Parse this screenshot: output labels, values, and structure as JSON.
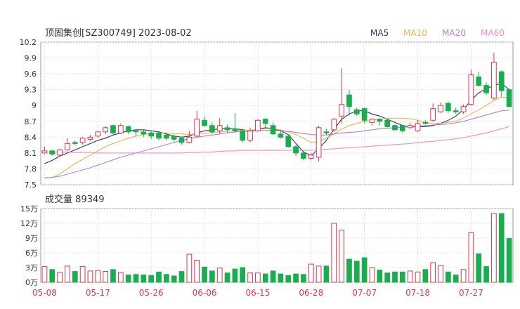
{
  "header": {
    "title": "顶固集创[SZ300749] 2023-08-02",
    "legend": [
      {
        "label": "MA5",
        "color": "#333366"
      },
      {
        "label": "MA10",
        "color": "#f0b24a"
      },
      {
        "label": "MA20",
        "color": "#b27fdc"
      },
      {
        "label": "MA60",
        "color": "#f08cc8"
      }
    ]
  },
  "volume_label": {
    "prefix": "成交量",
    "value": "89349"
  },
  "chart_data": [
    {
      "type": "candlestick",
      "title": "顶固集创[SZ300749] 2023-08-02",
      "y_ticks": [
        "10.2",
        "9.9",
        "9.6",
        "9.3",
        "9",
        "8.7",
        "8.4",
        "8.1",
        "7.8",
        "7.5"
      ],
      "ylim": [
        7.5,
        10.2
      ],
      "grid": true,
      "x_ticks": [
        {
          "i": 0,
          "label": "05-08"
        },
        {
          "i": 7,
          "label": "05-17"
        },
        {
          "i": 14,
          "label": "05-26"
        },
        {
          "i": 21,
          "label": "06-06"
        },
        {
          "i": 28,
          "label": "06-15"
        },
        {
          "i": 35,
          "label": "06-28"
        },
        {
          "i": 42,
          "label": "07-07"
        },
        {
          "i": 49,
          "label": "07-18"
        },
        {
          "i": 56,
          "label": "07-27"
        }
      ],
      "colors": {
        "up": "#e0344a",
        "down": "#1aad4f"
      },
      "candles": [
        [
          8.1,
          8.14,
          8.22,
          8.08
        ],
        [
          8.14,
          8.08,
          8.16,
          8.05
        ],
        [
          8.06,
          8.16,
          8.18,
          8.03
        ],
        [
          8.16,
          8.28,
          8.38,
          8.14
        ],
        [
          8.3,
          8.28,
          8.34,
          8.25
        ],
        [
          8.3,
          8.38,
          8.4,
          8.26
        ],
        [
          8.36,
          8.4,
          8.44,
          8.33
        ],
        [
          8.42,
          8.5,
          8.52,
          8.39
        ],
        [
          8.5,
          8.58,
          8.6,
          8.46
        ],
        [
          8.62,
          8.48,
          8.64,
          8.44
        ],
        [
          8.48,
          8.62,
          8.66,
          8.46
        ],
        [
          8.6,
          8.5,
          8.62,
          8.46
        ],
        [
          8.52,
          8.5,
          8.54,
          8.42
        ],
        [
          8.5,
          8.46,
          8.54,
          8.4
        ],
        [
          8.48,
          8.42,
          8.52,
          8.36
        ],
        [
          8.48,
          8.38,
          8.52,
          8.34
        ],
        [
          8.44,
          8.38,
          8.48,
          8.34
        ],
        [
          8.42,
          8.36,
          8.46,
          8.3
        ],
        [
          8.38,
          8.3,
          8.4,
          8.26
        ],
        [
          8.3,
          8.4,
          8.52,
          8.28
        ],
        [
          8.42,
          8.74,
          8.9,
          8.4
        ],
        [
          8.72,
          8.62,
          8.8,
          8.6
        ],
        [
          8.62,
          8.5,
          8.68,
          8.46
        ],
        [
          8.52,
          8.62,
          8.76,
          8.46
        ],
        [
          8.58,
          8.54,
          8.64,
          8.48
        ],
        [
          8.56,
          8.52,
          8.86,
          8.48
        ],
        [
          8.52,
          8.34,
          8.56,
          8.3
        ],
        [
          8.34,
          8.52,
          8.58,
          8.3
        ],
        [
          8.52,
          8.72,
          8.74,
          8.5
        ],
        [
          8.74,
          8.66,
          8.76,
          8.56
        ],
        [
          8.62,
          8.46,
          8.68,
          8.44
        ],
        [
          8.46,
          8.4,
          8.54,
          8.38
        ],
        [
          8.42,
          8.22,
          8.46,
          8.2
        ],
        [
          8.22,
          8.1,
          8.26,
          8.04
        ],
        [
          8.1,
          8.0,
          8.14,
          7.96
        ],
        [
          8.0,
          8.06,
          8.1,
          7.96
        ],
        [
          8.02,
          8.58,
          8.62,
          7.94
        ],
        [
          8.5,
          8.48,
          8.56,
          8.44
        ],
        [
          8.54,
          8.74,
          8.76,
          8.5
        ],
        [
          8.8,
          9.02,
          9.7,
          8.66
        ],
        [
          9.2,
          8.98,
          9.3,
          8.8
        ],
        [
          8.92,
          8.84,
          8.96,
          8.8
        ],
        [
          8.94,
          8.72,
          8.96,
          8.66
        ],
        [
          8.68,
          8.74,
          8.76,
          8.62
        ],
        [
          8.74,
          8.7,
          8.76,
          8.62
        ],
        [
          8.72,
          8.6,
          8.74,
          8.58
        ],
        [
          8.62,
          8.54,
          8.64,
          8.52
        ],
        [
          8.62,
          8.52,
          8.64,
          8.48
        ],
        [
          8.58,
          8.62,
          8.68,
          8.56
        ],
        [
          8.52,
          8.66,
          8.72,
          8.5
        ],
        [
          8.68,
          8.66,
          8.72,
          8.64
        ],
        [
          8.72,
          8.94,
          9.04,
          8.7
        ],
        [
          8.88,
          9.0,
          9.06,
          8.86
        ],
        [
          9.04,
          8.9,
          9.08,
          8.86
        ],
        [
          8.9,
          8.88,
          8.96,
          8.84
        ],
        [
          8.88,
          8.98,
          9.02,
          8.84
        ],
        [
          9.02,
          9.58,
          9.68,
          9.0
        ],
        [
          9.54,
          9.38,
          9.64,
          9.36
        ],
        [
          9.38,
          9.24,
          9.44,
          9.2
        ],
        [
          9.14,
          9.82,
          10.0,
          9.1
        ],
        [
          9.64,
          9.28,
          9.66,
          9.16
        ],
        [
          9.3,
          8.98,
          9.32,
          8.96
        ]
      ],
      "ma": [
        {
          "name": "MA5",
          "color": "#333366",
          "values": [
            7.9,
            7.96,
            8.04,
            8.1,
            8.16,
            8.22,
            8.28,
            8.34,
            8.38,
            8.44,
            8.48,
            8.52,
            8.54,
            8.54,
            8.52,
            8.5,
            8.46,
            8.42,
            8.4,
            8.42,
            8.48,
            8.52,
            8.54,
            8.56,
            8.56,
            8.56,
            8.54,
            8.52,
            8.55,
            8.58,
            8.56,
            8.52,
            8.45,
            8.28,
            8.12,
            8.05,
            8.18,
            8.34,
            8.55,
            8.74,
            8.84,
            8.9,
            8.9,
            8.84,
            8.8,
            8.74,
            8.68,
            8.62,
            8.59,
            8.6,
            8.6,
            8.62,
            8.66,
            8.72,
            8.8,
            8.92,
            9.1,
            9.24,
            9.32,
            9.38,
            9.42,
            9.3
          ]
        },
        {
          "name": "MA10",
          "color": "#f0b24a",
          "values": [
            7.62,
            7.64,
            7.7,
            7.8,
            7.9,
            7.98,
            8.06,
            8.14,
            8.22,
            8.28,
            8.33,
            8.38,
            8.42,
            8.45,
            8.47,
            8.48,
            8.48,
            8.47,
            8.46,
            8.45,
            8.46,
            8.47,
            8.49,
            8.5,
            8.51,
            8.52,
            8.53,
            8.53,
            8.55,
            8.56,
            8.56,
            8.54,
            8.5,
            8.45,
            8.38,
            8.3,
            8.32,
            8.38,
            8.46,
            8.55,
            8.62,
            8.66,
            8.7,
            8.72,
            8.74,
            8.76,
            8.76,
            8.76,
            8.75,
            8.72,
            8.68,
            8.66,
            8.66,
            8.68,
            8.7,
            8.76,
            8.84,
            8.92,
            9.0,
            9.1,
            9.16,
            9.15
          ]
        },
        {
          "name": "MA20",
          "color": "#b27fdc",
          "values": [
            7.63,
            7.64,
            7.66,
            7.7,
            7.74,
            7.78,
            7.82,
            7.87,
            7.92,
            7.97,
            8.02,
            8.06,
            8.1,
            8.14,
            8.18,
            8.22,
            8.26,
            8.3,
            8.34,
            8.37,
            8.4,
            8.42,
            8.44,
            8.46,
            8.48,
            8.5,
            8.51,
            8.51,
            8.52,
            8.53,
            8.53,
            8.52,
            8.51,
            8.49,
            8.47,
            8.45,
            8.44,
            8.44,
            8.46,
            8.48,
            8.49,
            8.5,
            8.52,
            8.54,
            8.56,
            8.57,
            8.58,
            8.59,
            8.6,
            8.61,
            8.62,
            8.63,
            8.64,
            8.65,
            8.67,
            8.7,
            8.74,
            8.78,
            8.82,
            8.86,
            8.9,
            8.91
          ]
        },
        {
          "name": "MA60",
          "color": "#f08cc8",
          "values": [
            8.12,
            8.12,
            8.12,
            8.12,
            8.11,
            8.11,
            8.11,
            8.1,
            8.1,
            8.1,
            8.1,
            8.1,
            8.1,
            8.1,
            8.1,
            8.1,
            8.1,
            8.1,
            8.1,
            8.11,
            8.11,
            8.12,
            8.12,
            8.13,
            8.14,
            8.14,
            8.15,
            8.15,
            8.15,
            8.15,
            8.15,
            8.15,
            8.15,
            8.15,
            8.15,
            8.15,
            8.16,
            8.17,
            8.18,
            8.19,
            8.2,
            8.21,
            8.22,
            8.23,
            8.24,
            8.25,
            8.26,
            8.27,
            8.28,
            8.3,
            8.31,
            8.32,
            8.34,
            8.35,
            8.37,
            8.39,
            8.42,
            8.45,
            8.48,
            8.52,
            8.56,
            8.6
          ]
        }
      ]
    },
    {
      "type": "bar",
      "title": "成交量 89349",
      "y_ticks": [
        "15万",
        "12万",
        "9万",
        "6万",
        "3万",
        "0万"
      ],
      "ylim": [
        0,
        150000
      ],
      "values": [
        32000,
        26000,
        20000,
        33000,
        22000,
        32000,
        23000,
        24000,
        22000,
        26000,
        20000,
        15000,
        16000,
        15000,
        14000,
        21000,
        16000,
        13000,
        22000,
        57000,
        45000,
        31000,
        23000,
        29000,
        19000,
        27000,
        30000,
        19000,
        19000,
        17000,
        23000,
        17000,
        14000,
        17000,
        16000,
        37000,
        33000,
        33000,
        120000,
        106000,
        47000,
        43000,
        50000,
        30000,
        25000,
        19000,
        21000,
        21000,
        23000,
        21000,
        26000,
        40000,
        34000,
        21000,
        15000,
        26000,
        101000,
        58000,
        32000,
        140000,
        140000,
        89349
      ]
    }
  ]
}
